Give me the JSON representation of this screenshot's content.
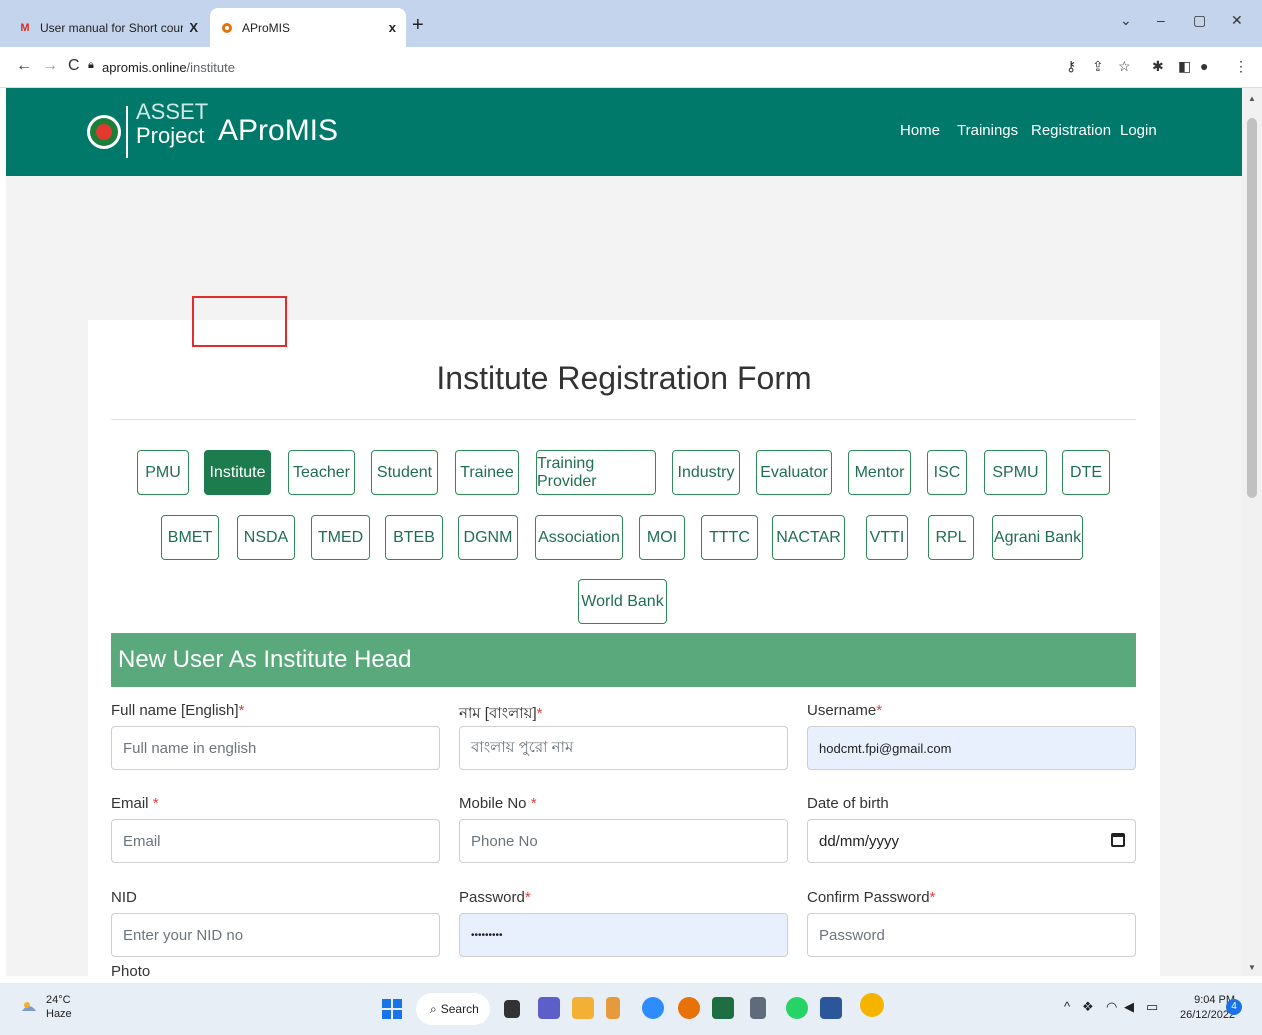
{
  "browser": {
    "tabs": [
      {
        "title": "User manual for Short course Elic",
        "close": "X"
      },
      {
        "title": "AProMIS",
        "close": "x"
      }
    ],
    "new_tab": "+",
    "url_host": "apromis.online",
    "url_path": "/institute"
  },
  "header": {
    "logo_line1": "ASSET",
    "logo_line2": "Project",
    "brand": "AProMIS",
    "nav": [
      "Home",
      "Trainings",
      "Registration",
      "Login"
    ]
  },
  "form": {
    "title": "Institute Registration Form",
    "roles_row1": [
      "PMU",
      "Institute",
      "Teacher",
      "Student",
      "Trainee",
      "Training Provider",
      "Industry",
      "Evaluator",
      "Mentor",
      "ISC",
      "SPMU",
      "DTE"
    ],
    "roles_row2": [
      "BMET",
      "NSDA",
      "TMED",
      "BTEB",
      "DGNM",
      "Association",
      "MOI",
      "TTTC",
      "NACTAR",
      "VTTI",
      "RPL",
      "Agrani Bank"
    ],
    "roles_row3": [
      "World Bank"
    ],
    "active_role": "Institute",
    "section_title": "New User As Institute Head",
    "fields": {
      "fullname_en": {
        "label": "Full name [English]",
        "placeholder": "Full name in english"
      },
      "name_bn": {
        "label": "নাম [বাংলায়]",
        "placeholder": "বাংলায় পুরো নাম"
      },
      "username": {
        "label": "Username",
        "value": "hodcmt.fpi@gmail.com"
      },
      "email": {
        "label": "Email ",
        "placeholder": "Email"
      },
      "mobile": {
        "label": "Mobile No ",
        "placeholder": "Phone No"
      },
      "dob": {
        "label": "Date of birth",
        "value": "dd/mm/yyyy"
      },
      "nid": {
        "label": "NID",
        "placeholder": "Enter your NID no"
      },
      "password": {
        "label": "Password",
        "value": "•••••••••"
      },
      "confirm_password": {
        "label": "Confirm Password",
        "placeholder": "Password"
      },
      "photo": {
        "label": "Photo"
      }
    },
    "required_mark": "*"
  },
  "taskbar": {
    "temperature": "24°C",
    "weather": "Haze",
    "search": "Search",
    "time": "9:04 PM",
    "date": "26/12/2022",
    "notifications": "4"
  },
  "colors": {
    "header_bg": "#00796b",
    "section_bg": "#5aa97d",
    "active_role": "#1c7c4e",
    "highlight_box": "#e32d2d"
  }
}
